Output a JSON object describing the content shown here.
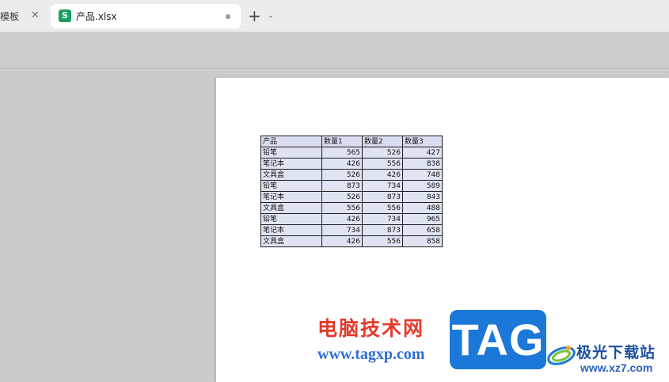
{
  "tabs": {
    "previous": {
      "label": "模板"
    },
    "active": {
      "label": "产品.xlsx",
      "app_icon_letter": "S"
    }
  },
  "sheet": {
    "headers": [
      "产品",
      "数量1",
      "数量2",
      "数量3"
    ],
    "rows": [
      [
        "铅笔",
        "565",
        "526",
        "427"
      ],
      [
        "笔记本",
        "426",
        "556",
        "838"
      ],
      [
        "文具盒",
        "526",
        "426",
        "748"
      ],
      [
        "铅笔",
        "873",
        "734",
        "589"
      ],
      [
        "笔记本",
        "526",
        "873",
        "843"
      ],
      [
        "文具盒",
        "556",
        "556",
        "488"
      ],
      [
        "铅笔",
        "426",
        "734",
        "965"
      ],
      [
        "笔记本",
        "734",
        "873",
        "658"
      ],
      [
        "文具盒",
        "426",
        "556",
        "858"
      ]
    ]
  },
  "watermark": {
    "text": "电脑技术网",
    "url": "www.tagxp.com",
    "badge": "TAG",
    "site_name": "极光下载站",
    "site_url": "www.xz7.com"
  },
  "colors": {
    "app_icon": "#1a9e66",
    "watermark_red": "#e23b2c",
    "watermark_blue": "#1c78d8",
    "cell_fill": "#dfe4f3"
  }
}
